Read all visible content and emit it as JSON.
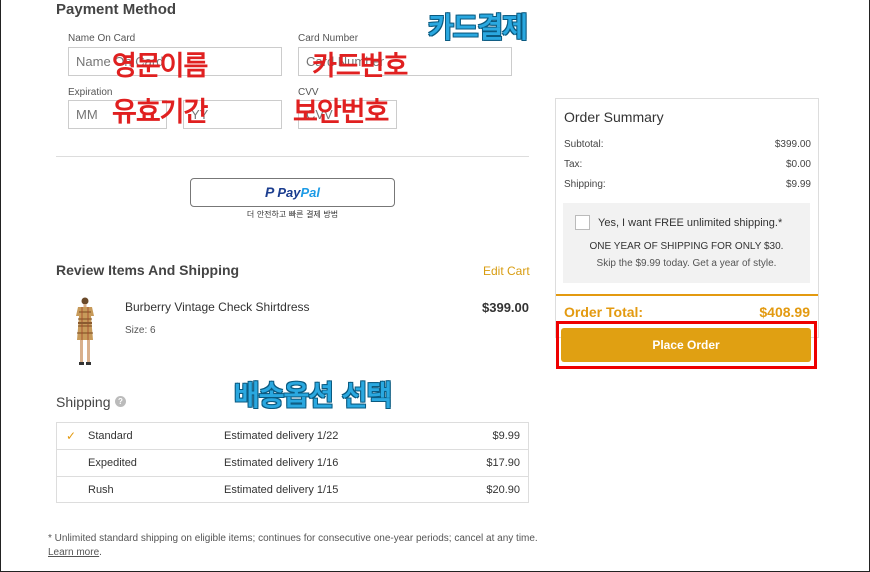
{
  "payment": {
    "title": "Payment Method",
    "name_label": "Name On Card",
    "name_placeholder": "Name On Card",
    "card_label": "Card Number",
    "card_placeholder": "Card Number",
    "exp_label": "Expiration",
    "mm_placeholder": "MM",
    "yy_placeholder": "YY",
    "cvv_label": "CVV",
    "cvv_placeholder": "CVV"
  },
  "annotations": {
    "card_payment": "카드결제",
    "english_name": "영문이름",
    "card_number": "카드번호",
    "expiry": "유효기간",
    "security_number": "보안번호",
    "shipping_option": "배송옵션 선택"
  },
  "paypal": {
    "pay": "Pay",
    "pal": "Pal",
    "note": "더 안전하고 빠른 결제 방법"
  },
  "review": {
    "title": "Review Items And Shipping",
    "edit_cart": "Edit Cart",
    "product_name": "Burberry Vintage Check Shirtdress",
    "product_size": "Size: 6",
    "product_price": "$399.00"
  },
  "shipping": {
    "title": "Shipping",
    "help": "?",
    "options": [
      {
        "name": "Standard",
        "estimate": "Estimated delivery 1/22",
        "price": "$9.99",
        "selected": true
      },
      {
        "name": "Expedited",
        "estimate": "Estimated delivery 1/16",
        "price": "$17.90",
        "selected": false
      },
      {
        "name": "Rush",
        "estimate": "Estimated delivery 1/15",
        "price": "$20.90",
        "selected": false
      }
    ]
  },
  "footnote": {
    "text": "* Unlimited standard shipping on eligible items; continues for consecutive one-year periods; cancel at any time.",
    "link": "Learn more",
    "end": "."
  },
  "summary": {
    "title": "Order Summary",
    "subtotal_label": "Subtotal:",
    "subtotal": "$399.00",
    "tax_label": "Tax:",
    "tax": "$0.00",
    "shipping_label": "Shipping:",
    "shipping": "$9.99",
    "promo_label": "Yes, I want FREE unlimited shipping.*",
    "promo_line1": "ONE YEAR OF SHIPPING FOR ONLY $30.",
    "promo_line2": "Skip the $9.99 today. Get a year of style.",
    "total_label": "Order Total:",
    "total": "$408.99",
    "place_order": "Place Order"
  },
  "colors": {
    "accent": "#e0a012",
    "highlight": "#ee0000",
    "annotation_red": "#e02020",
    "annotation_blue": "#2aa8e0"
  }
}
